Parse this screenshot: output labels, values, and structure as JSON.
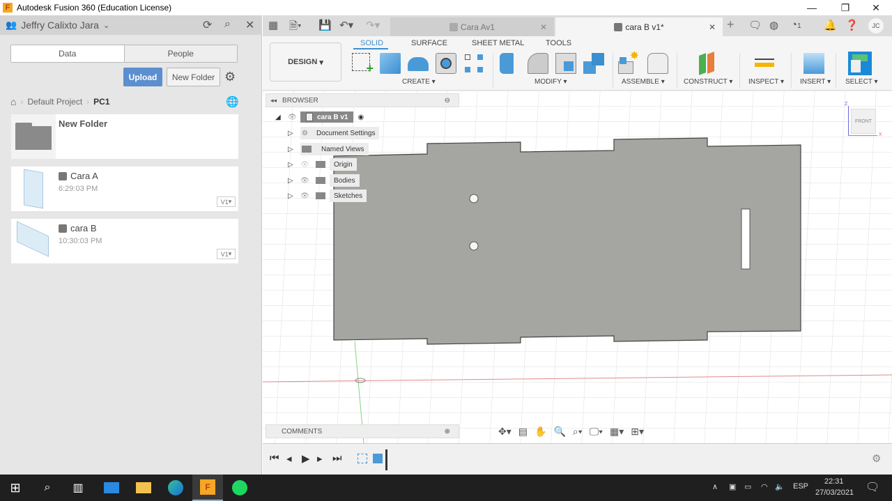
{
  "window": {
    "title": "Autodesk Fusion 360 (Education License)",
    "logo_letter": "F",
    "minimize": "—",
    "restore": "❐",
    "close": "✕"
  },
  "left_panel": {
    "user_name": "Jeffry Calixto Jara",
    "tabs": [
      "Data",
      "People"
    ],
    "upload_label": "Upload",
    "new_folder_label": "New Folder",
    "breadcrumb": [
      "Default Project",
      "PC1"
    ],
    "items": [
      {
        "name": "New Folder",
        "type": "folder"
      },
      {
        "name": "Cara A",
        "time": "6:29:03 PM",
        "version": "V1"
      },
      {
        "name": "cara B",
        "time": "10:30:03 PM",
        "version": "V1"
      }
    ]
  },
  "topbar": {
    "tabs": [
      {
        "label": "Cara Av1",
        "active": false
      },
      {
        "label": "cara B v1*",
        "active": true
      }
    ],
    "job_count": "1",
    "user_initials": "JC"
  },
  "ribbon": {
    "workspace": "DESIGN",
    "tabs": [
      "SOLID",
      "SURFACE",
      "SHEET METAL",
      "TOOLS"
    ],
    "active_tab": "SOLID",
    "groups": [
      "CREATE",
      "MODIFY",
      "ASSEMBLE",
      "CONSTRUCT",
      "INSPECT",
      "INSERT",
      "SELECT"
    ]
  },
  "browser": {
    "title": "BROWSER",
    "root": "cara B v1",
    "nodes": [
      "Document Settings",
      "Named Views",
      "Origin",
      "Bodies",
      "Sketches"
    ]
  },
  "viewcube": {
    "face": "FRONT",
    "axis_z": "Z",
    "axis_x": "X"
  },
  "comments": {
    "title": "COMMENTS"
  },
  "taskbar": {
    "language": "ESP",
    "time": "22:31",
    "date": "27/03/2021"
  },
  "colors": {
    "accent": "#3a8fd0",
    "upload": "#5b8fce",
    "body": "#a5a5a1"
  }
}
